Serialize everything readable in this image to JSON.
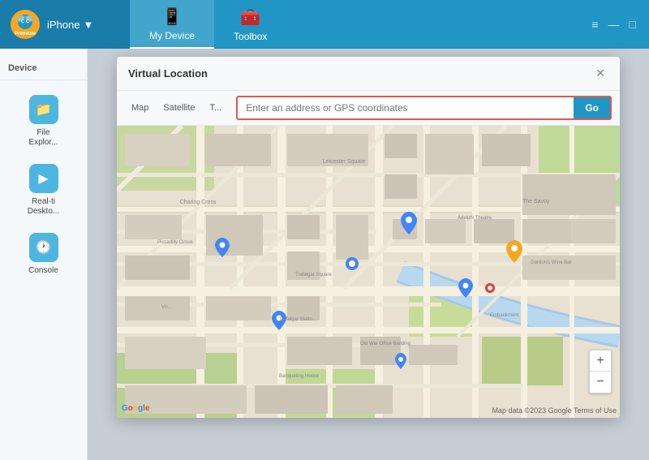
{
  "app": {
    "title": "iPhone",
    "premium_label": "Premium",
    "window_controls": [
      "≡",
      "—",
      "□"
    ]
  },
  "nav": {
    "tabs": [
      {
        "id": "my-device",
        "label": "My Device",
        "icon": "📱",
        "active": true
      },
      {
        "id": "toolbox",
        "label": "Toolbox",
        "icon": "🧰",
        "active": false
      }
    ]
  },
  "sidebar": {
    "device_info_label": "Device",
    "items": [
      {
        "id": "file-explorer",
        "label": "File\nExplor...",
        "icon": "📁"
      },
      {
        "id": "realtime-desktop",
        "label": "Real-ti\nDeskto...",
        "icon": "▶"
      },
      {
        "id": "console",
        "label": "Console",
        "icon": "🕐"
      }
    ]
  },
  "dialog": {
    "title": "Virtual Location",
    "close_label": "✕",
    "map_tabs": [
      "Map",
      "Satellite",
      "T..."
    ],
    "search_placeholder": "Enter an address or GPS coordinates",
    "go_button_label": "Go",
    "map_footer": "Map data ©2023 Google   Terms of Use",
    "google_letters": [
      "G",
      "o",
      "o",
      "g",
      "l",
      "e"
    ]
  }
}
